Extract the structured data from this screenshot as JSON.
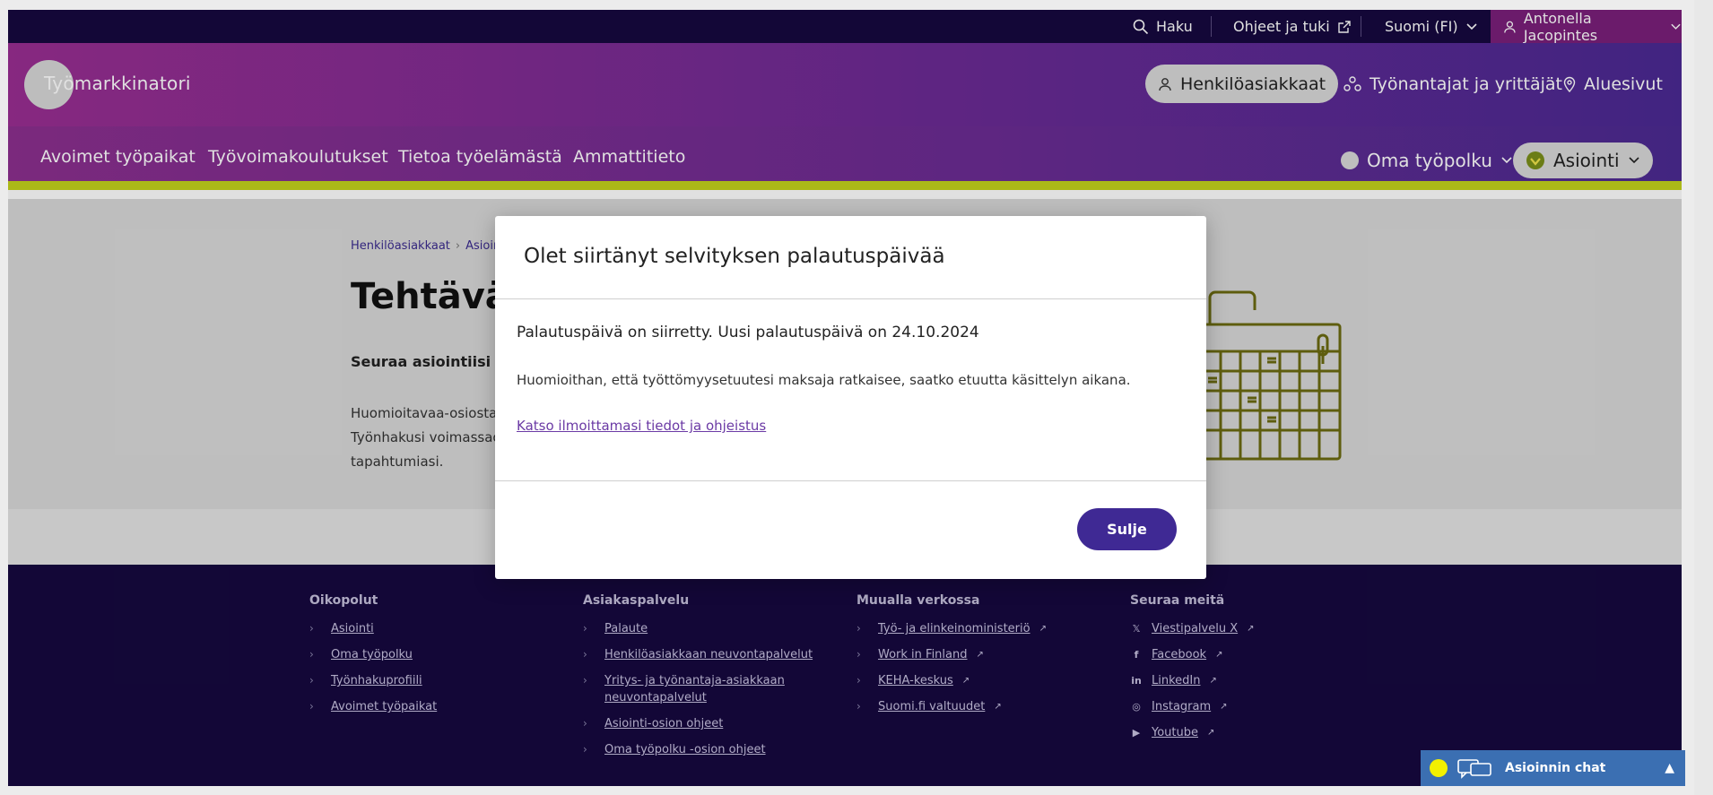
{
  "topbar": {
    "search": "Haku",
    "help": "Ohjeet ja tuki",
    "language": "Suomi (FI)",
    "user": "Antonella Jacopintes"
  },
  "header": {
    "logo": "Työmarkkinatori",
    "buttons": [
      "Henkilöasiakkaat",
      "Työnantajat ja yrittäjät",
      "Aluesivut"
    ]
  },
  "nav": {
    "links": [
      "Avoimet työpaikat",
      "Työvoimakoulutukset",
      "Tietoa työelämästä",
      "Ammattitieto"
    ],
    "oma": "Oma työpolku",
    "asiointi": "Asiointi"
  },
  "hero": {
    "crumbs": [
      "Henkilöasiakkaat",
      "Asiointi"
    ],
    "title": "Tehtävät j",
    "lead": "Seuraa asiointiisi liitty",
    "info_lines": [
      "Huomioitavaa-osiosta lö",
      "Työnhakusi voimassaolo",
      "tapahtumiasi."
    ]
  },
  "modal": {
    "title": "Olet siirtänyt selvityksen palautuspäivää",
    "subtitle": "Palautuspäivä on siirretty. Uusi palautuspäivä on 24.10.2024",
    "text": "Huomioithan, että työttömyysetuutesi maksaja ratkaisee, saatko etuutta käsittelyn aikana.",
    "link": "Katso ilmoittamasi tiedot ja ohjeistus",
    "close": "Sulje"
  },
  "footer": {
    "columns": [
      {
        "title": "Oikopolut",
        "items": [
          "Asiointi",
          "Oma työpolku",
          "Työnhakuprofiili",
          "Avoimet työpaikat"
        ]
      },
      {
        "title": "Asiakaspalvelu",
        "items": [
          "Palaute",
          "Henkilöasiakkaan neuvontapalvelut",
          "Yritys- ja työnantaja-asiakkaan",
          "neuvontapalvelut",
          "Asiointi-osion ohjeet",
          "Oma työpolku -osion ohjeet"
        ]
      },
      {
        "title": "Muualla verkossa",
        "items": [
          "Työ- ja elinkeinoministeriö",
          "Work in Finland",
          "KEHA-keskus",
          "Suomi.fi valtuudet"
        ]
      },
      {
        "title": "Seuraa meitä",
        "items": [
          "Viestipalvelu X",
          "Facebook",
          "LinkedIn",
          "Instagram",
          "Youtube"
        ]
      }
    ]
  },
  "chat": {
    "label": "Asioinnin chat"
  },
  "colors": {
    "topbar": "#16093f",
    "brand_purple": "#6c2b94",
    "accent_lime": "#c3d21c",
    "button_primary": "#3f2994",
    "chat_blue": "#3b6fb2"
  }
}
